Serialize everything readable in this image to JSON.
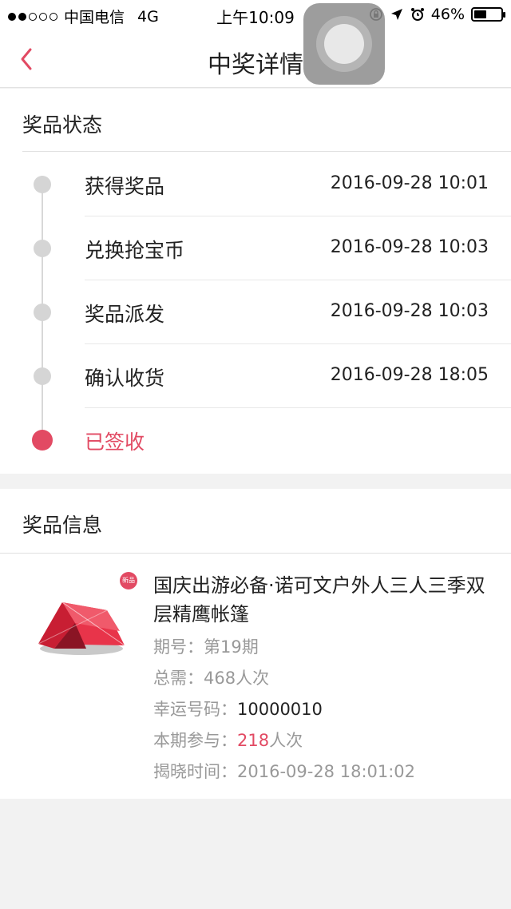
{
  "status_bar": {
    "carrier": "中国电信",
    "network": "4G",
    "time": "上午10:09",
    "battery": "46%",
    "battery_level": 0.46
  },
  "nav": {
    "title": "中奖详情"
  },
  "status_section": {
    "title": "奖品状态",
    "steps": [
      {
        "label": "获得奖品",
        "time": "2016-09-28 10:01"
      },
      {
        "label": "兑换抢宝币",
        "time": "2016-09-28 10:03"
      },
      {
        "label": "奖品派发",
        "time": "2016-09-28 10:03"
      },
      {
        "label": "确认收货",
        "time": "2016-09-28 18:05"
      },
      {
        "label": "已签收",
        "time": ""
      }
    ]
  },
  "info_section": {
    "title": "奖品信息",
    "badge": "新品",
    "product_title": "国庆出游必备·诺可文户外人三人三季双层精鹰帐篷",
    "period_label": "期号：",
    "period_value": "第19期",
    "total_label": "总需：",
    "total_value": "468人次",
    "lucky_label": "幸运号码：",
    "lucky_value": "10000010",
    "participate_label": "本期参与：",
    "participate_count": "218",
    "participate_unit": "人次",
    "reveal_label": "揭晓时间：",
    "reveal_value": "2016-09-28 18:01:02"
  },
  "colors": {
    "accent": "#e24a63",
    "inactive_dot": "#d5d5d5",
    "background": "#f2f2f2"
  }
}
